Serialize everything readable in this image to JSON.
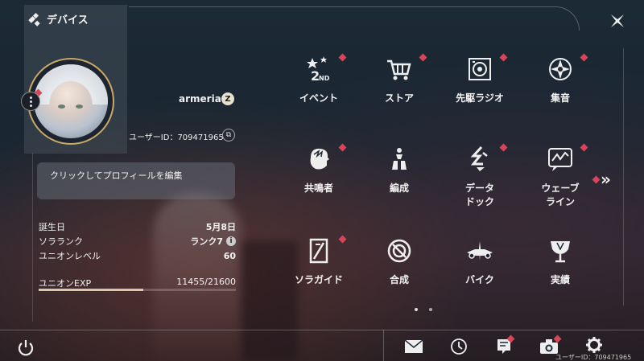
{
  "header": {
    "title": "デバイス"
  },
  "profile": {
    "username": "armeria",
    "user_id_label": "ユーザーID：709471965",
    "edit_prompt": "クリックしてプロフィールを編集",
    "edit_icon": "Z",
    "copy_icon": "⧉"
  },
  "stats": [
    {
      "label": "誕生日",
      "value": "5月8日"
    },
    {
      "label": "ソラランク",
      "value": "ランク7"
    },
    {
      "label": "ユニオンレベル",
      "value": "60"
    }
  ],
  "exp": {
    "label": "ユニオンEXP",
    "value": "11455/21600",
    "fraction": 0.53
  },
  "menu": [
    {
      "label": "イベント",
      "icon": "event-icon"
    },
    {
      "label": "ストア",
      "icon": "store-cart-icon"
    },
    {
      "label": "先駆ラジオ",
      "icon": "radio-icon"
    },
    {
      "label": "集音",
      "icon": "sound-collect-icon"
    },
    {
      "label": "共鳴者",
      "icon": "resonator-icon"
    },
    {
      "label": "編成",
      "icon": "team-icon"
    },
    {
      "label": "データ\nドック",
      "icon": "data-dock-icon"
    },
    {
      "label": "ウェーブ\nライン",
      "icon": "waveline-icon"
    },
    {
      "label": "ソラガイド",
      "icon": "guide-icon"
    },
    {
      "label": "合成",
      "icon": "synthesis-icon"
    },
    {
      "label": "バイク",
      "icon": "bike-icon"
    },
    {
      "label": "実績",
      "icon": "achievement-icon"
    }
  ],
  "more_arrow": "»",
  "info_icon": "i",
  "bottom": {
    "user_id": "ユーザーID：709471965"
  },
  "colors": {
    "accent_gold": "#c9a968",
    "notify_red": "#d8445a"
  }
}
